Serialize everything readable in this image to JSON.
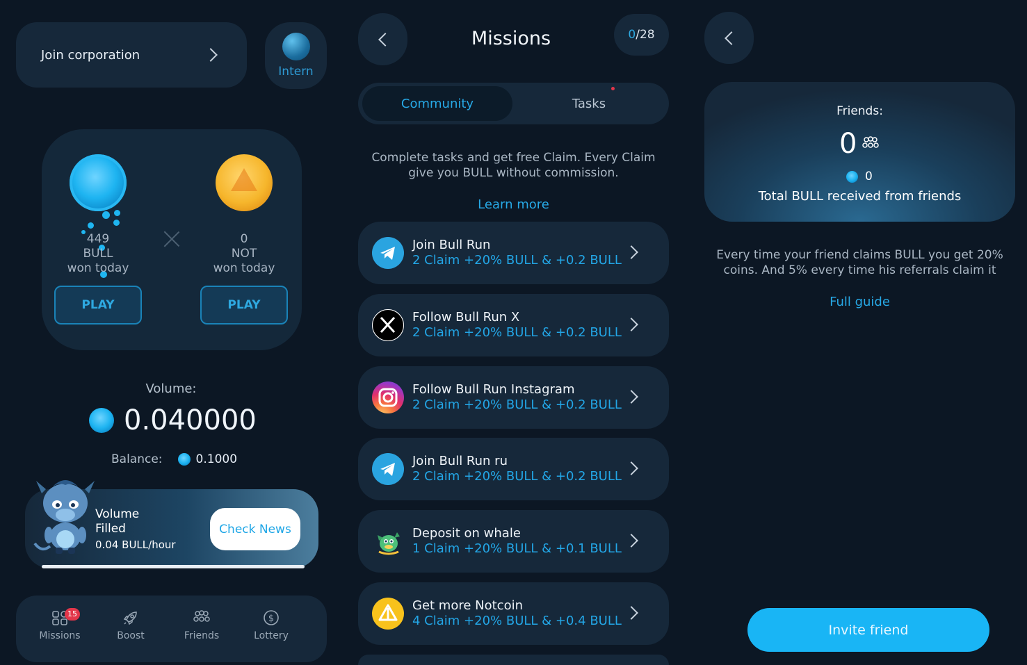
{
  "left": {
    "join_label": "Join corporation",
    "rank_label": "Intern",
    "games": [
      {
        "count": "449",
        "currency": "BULL",
        "caption": "won today",
        "play_label": "PLAY"
      },
      {
        "count": "0",
        "currency": "NOT",
        "caption": "won today",
        "play_label": "PLAY"
      }
    ],
    "volume_label": "Volume:",
    "volume_value": "0.040000",
    "balance_label": "Balance:",
    "balance_value": "0.1000",
    "news": {
      "line1": "Volume",
      "line2": "Filled",
      "rate": "0.04 BULL/hour",
      "button": "Check News",
      "progress": 1.0
    },
    "nav": [
      {
        "label": "Missions",
        "badge": "15",
        "icon": "missions-icon"
      },
      {
        "label": "Boost",
        "icon": "rocket-icon"
      },
      {
        "label": "Friends",
        "icon": "friends-icon"
      },
      {
        "label": "Lottery",
        "icon": "dollar-icon"
      }
    ]
  },
  "middle": {
    "title": "Missions",
    "counter_current": "0",
    "counter_total": "/28",
    "tabs": [
      "Community",
      "Tasks"
    ],
    "intro": "Complete tasks and get free Claim. Every Claim give you BULL without commission.",
    "learn_more": "Learn more",
    "missions": [
      {
        "title": "Join Bull Run",
        "reward": "2 Claim +20% BULL & +0.2 BULL",
        "icon": "telegram-icon"
      },
      {
        "title": "Follow Bull Run X",
        "reward": "2 Claim +20% BULL & +0.2 BULL",
        "icon": "x-icon"
      },
      {
        "title": "Follow Bull Run Instagram",
        "reward": "2 Claim +20% BULL & +0.2 BULL",
        "icon": "instagram-icon"
      },
      {
        "title": "Join Bull Run ru",
        "reward": "2 Claim +20% BULL & +0.2 BULL",
        "icon": "telegram-icon"
      },
      {
        "title": "Deposit on whale",
        "reward": "1 Claim +20% BULL & +0.1 BULL",
        "icon": "whale-icon"
      },
      {
        "title": "Get more Notcoin",
        "reward": "4 Claim +20% BULL & +0.4 BULL",
        "icon": "notcoin-icon"
      }
    ]
  },
  "right": {
    "friends_label": "Friends:",
    "friends_count": "0",
    "bull_received": "0",
    "total_label": "Total BULL received from friends",
    "description": "Every time your friend claims BULL you get 20% coins. And 5% every time his referrals claim it",
    "guide": "Full guide",
    "invite": "Invite friend"
  },
  "colors": {
    "background": "#0c1724",
    "card": "#16283a",
    "accent": "#27a9e6",
    "invite_button": "#19b5f5"
  }
}
